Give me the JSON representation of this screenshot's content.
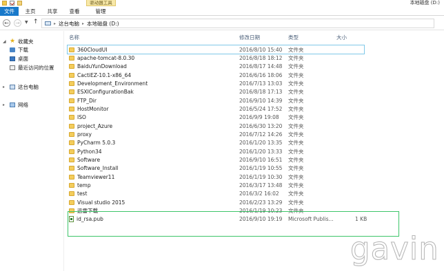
{
  "titlebar": {
    "context_tab": "驱动器工具",
    "window_title": "本地磁盘 (D:)"
  },
  "ribbon": {
    "tabs": [
      "文件",
      "主页",
      "共享",
      "查看",
      "管理"
    ]
  },
  "address": {
    "crumbs": [
      "这台电脑",
      "本地磁盘 (D:)"
    ]
  },
  "sidebar": {
    "favorites": "收藏夹",
    "items": [
      "下载",
      "桌面",
      "最近访问的位置"
    ],
    "this_pc": "这台电脑",
    "network": "网络"
  },
  "columns": {
    "name": "名称",
    "date": "修改日期",
    "type": "类型",
    "size": "大小"
  },
  "files": [
    {
      "name": "360CloudUI",
      "date": "2016/8/10 15:40",
      "type": "文件夹",
      "size": ""
    },
    {
      "name": "apache-tomcat-8.0.30",
      "date": "2016/8/18 18:12",
      "type": "文件夹",
      "size": ""
    },
    {
      "name": "BaiduYunDownload",
      "date": "2016/8/17 14:48",
      "type": "文件夹",
      "size": ""
    },
    {
      "name": "CactiEZ-10.1-x86_64",
      "date": "2016/6/16 18:06",
      "type": "文件夹",
      "size": ""
    },
    {
      "name": "Development_Environment",
      "date": "2016/7/13 13:03",
      "type": "文件夹",
      "size": ""
    },
    {
      "name": "ESXIConfigurationBak",
      "date": "2016/8/18 17:13",
      "type": "文件夹",
      "size": ""
    },
    {
      "name": "FTP_Dir",
      "date": "2016/9/10 14:39",
      "type": "文件夹",
      "size": ""
    },
    {
      "name": "HostMonitor",
      "date": "2016/5/24 17:52",
      "type": "文件夹",
      "size": ""
    },
    {
      "name": "ISO",
      "date": "2016/9/9 19:08",
      "type": "文件夹",
      "size": ""
    },
    {
      "name": "project_Azure",
      "date": "2016/6/30 13:20",
      "type": "文件夹",
      "size": ""
    },
    {
      "name": "proxy",
      "date": "2016/7/12 14:26",
      "type": "文件夹",
      "size": ""
    },
    {
      "name": "PyCharm 5.0.3",
      "date": "2016/1/20 13:35",
      "type": "文件夹",
      "size": ""
    },
    {
      "name": "Python34",
      "date": "2016/1/20 13:33",
      "type": "文件夹",
      "size": ""
    },
    {
      "name": "Software",
      "date": "2016/9/10 16:51",
      "type": "文件夹",
      "size": ""
    },
    {
      "name": "Software_Install",
      "date": "2016/1/19 10:55",
      "type": "文件夹",
      "size": ""
    },
    {
      "name": "Teamviewer11",
      "date": "2016/1/19 10:30",
      "type": "文件夹",
      "size": ""
    },
    {
      "name": "temp",
      "date": "2016/3/17 13:48",
      "type": "文件夹",
      "size": ""
    },
    {
      "name": "test",
      "date": "2016/3/2 16:02",
      "type": "文件夹",
      "size": ""
    },
    {
      "name": "Visual studio 2015",
      "date": "2016/2/23 13:29",
      "type": "文件夹",
      "size": ""
    },
    {
      "name": "迅雷下载",
      "date": "2016/1/19 10:23",
      "type": "文件夹",
      "size": ""
    },
    {
      "name": "id_rsa.pub",
      "date": "2016/9/10 19:19",
      "type": "Microsoft Publis...",
      "size": "1 KB"
    }
  ],
  "watermark": "gavin"
}
